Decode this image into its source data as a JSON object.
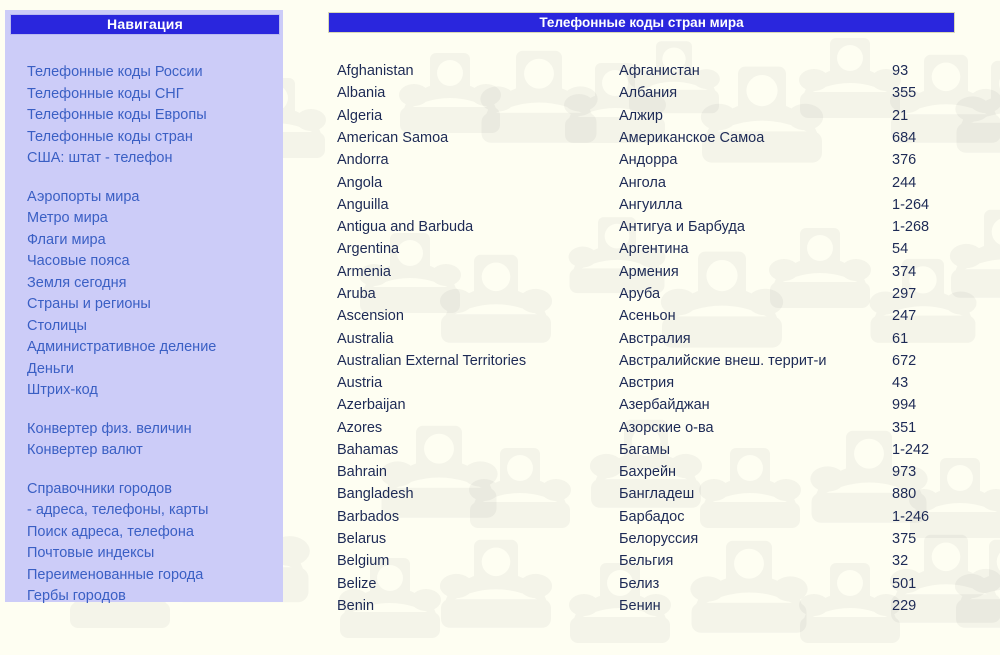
{
  "sidebar": {
    "header_title": "Навигация",
    "groups": [
      {
        "group_name": "phone-codes",
        "items": [
          {
            "label": "Телефонные коды России"
          },
          {
            "label": "Телефонные коды СНГ"
          },
          {
            "label": "Телефонные коды Европы"
          },
          {
            "label": "Телефонные коды стран"
          },
          {
            "label": "США: штат - телефон"
          }
        ]
      },
      {
        "group_name": "world-reference",
        "items": [
          {
            "label": "Аэропорты мира"
          },
          {
            "label": "Метро мира"
          },
          {
            "label": "Флаги мира"
          },
          {
            "label": "Часовые пояса"
          },
          {
            "label": "Земля сегодня"
          },
          {
            "label": "Страны и регионы"
          },
          {
            "label": "Столицы"
          },
          {
            "label": "Административное деление"
          },
          {
            "label": "Деньги"
          },
          {
            "label": "Штрих-код"
          }
        ]
      },
      {
        "group_name": "converters",
        "items": [
          {
            "label": "Конвертер физ. величин"
          },
          {
            "label": "Конвертер валют"
          }
        ]
      },
      {
        "group_name": "city-directories",
        "items": [
          {
            "label": "Справочники городов"
          },
          {
            "label": "- адреса, телефоны, карты"
          },
          {
            "label": "Поиск адреса, телефона"
          },
          {
            "label": "Почтовые индексы"
          },
          {
            "label": "Переименованные города"
          },
          {
            "label": "Гербы городов"
          }
        ]
      }
    ]
  },
  "main": {
    "header_title": "Телефонные коды стран мира",
    "table": {
      "rows": [
        {
          "en": "Afghanistan",
          "ru": "Афганистан",
          "code": "93"
        },
        {
          "en": "Albania",
          "ru": "Албания",
          "code": "355"
        },
        {
          "en": "Algeria",
          "ru": "Алжир",
          "code": "21"
        },
        {
          "en": "American Samoa",
          "ru": "Американское Самоа",
          "code": "684"
        },
        {
          "en": "Andorra",
          "ru": "Андорра",
          "code": "376"
        },
        {
          "en": "Angola",
          "ru": "Ангола",
          "code": "244"
        },
        {
          "en": "Anguilla",
          "ru": "Ангуилла",
          "code": "1-264"
        },
        {
          "en": "Antigua and Barbuda",
          "ru": "Антигуа и Барбуда",
          "code": "1-268"
        },
        {
          "en": "Argentina",
          "ru": "Аргентина",
          "code": "54"
        },
        {
          "en": "Armenia",
          "ru": "Армения",
          "code": "374"
        },
        {
          "en": "Aruba",
          "ru": "Аруба",
          "code": "297"
        },
        {
          "en": "Ascension",
          "ru": "Асеньон",
          "code": "247"
        },
        {
          "en": "Australia",
          "ru": "Австралия",
          "code": "61"
        },
        {
          "en": "Australian External Territories",
          "ru": "Австралийские внеш. террит-и",
          "code": "672"
        },
        {
          "en": "Austria",
          "ru": "Австрия",
          "code": "43"
        },
        {
          "en": "Azerbaijan",
          "ru": "Азербайджан",
          "code": "994"
        },
        {
          "en": "Azores",
          "ru": "Азорские о-ва",
          "code": "351"
        },
        {
          "en": "Bahamas",
          "ru": "Багамы",
          "code": "1-242"
        },
        {
          "en": "Bahrain",
          "ru": "Бахрейн",
          "code": "973"
        },
        {
          "en": "Bangladesh",
          "ru": "Бангладеш",
          "code": "880"
        },
        {
          "en": "Barbados",
          "ru": "Барбадос",
          "code": "1-246"
        },
        {
          "en": "Belarus",
          "ru": "Белоруссия",
          "code": "375"
        },
        {
          "en": "Belgium",
          "ru": "Бельгия",
          "code": "32"
        },
        {
          "en": "Belize",
          "ru": "Белиз",
          "code": "501"
        },
        {
          "en": "Benin",
          "ru": "Бенин",
          "code": "229"
        }
      ]
    }
  },
  "theme": {
    "header_bar_color": "#2a26dd",
    "sidebar_bg_color": "#ccccf8",
    "link_color": "#3a5fc4",
    "table_text_color": "#1d2a55",
    "page_bg_color": "#fefef2"
  },
  "decorations": {
    "watermark_icon": "telephone-watermark"
  }
}
